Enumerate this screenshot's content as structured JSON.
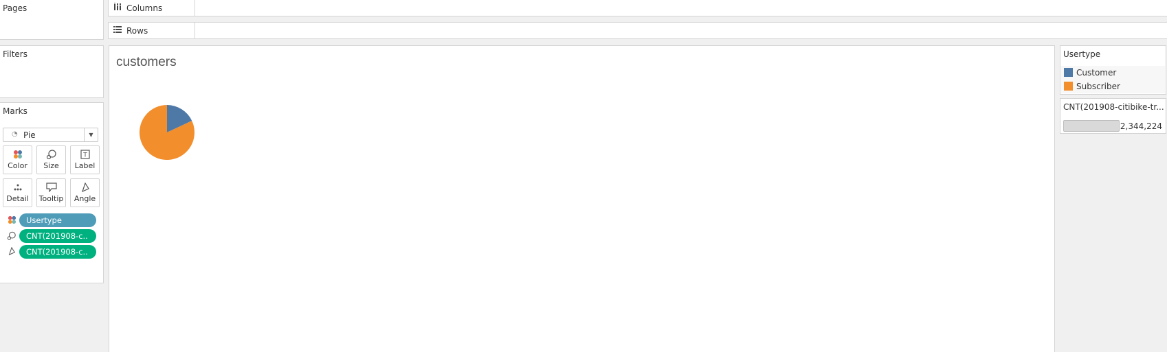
{
  "pages": {
    "title": "Pages"
  },
  "filters": {
    "title": "Filters"
  },
  "marks": {
    "title": "Marks",
    "mark_type": "Pie",
    "buttons": {
      "color": "Color",
      "size": "Size",
      "label": "Label",
      "detail": "Detail",
      "tooltip": "Tooltip",
      "angle": "Angle"
    },
    "pills": [
      {
        "label": "Usertype",
        "kind": "dimension",
        "icon": "color-icon"
      },
      {
        "label": "CNT(201908-c..",
        "kind": "measure",
        "icon": "size-icon"
      },
      {
        "label": "CNT(201908-c..",
        "kind": "measure",
        "icon": "angle-icon"
      }
    ]
  },
  "shelves": {
    "columns": "Columns",
    "rows": "Rows"
  },
  "sheet": {
    "title": "customers"
  },
  "legend_color": {
    "title": "Usertype",
    "items": [
      {
        "label": "Customer",
        "color": "#4e79a7"
      },
      {
        "label": "Subscriber",
        "color": "#f28e2b"
      }
    ]
  },
  "legend_size": {
    "title": "CNT(201908-citibike-tr...",
    "value": "2,344,224"
  },
  "chart_data": {
    "type": "pie",
    "categories": [
      "Customer",
      "Subscriber"
    ],
    "values": [
      0.18,
      0.82
    ],
    "colors": [
      "#4e79a7",
      "#f28e2b"
    ]
  }
}
